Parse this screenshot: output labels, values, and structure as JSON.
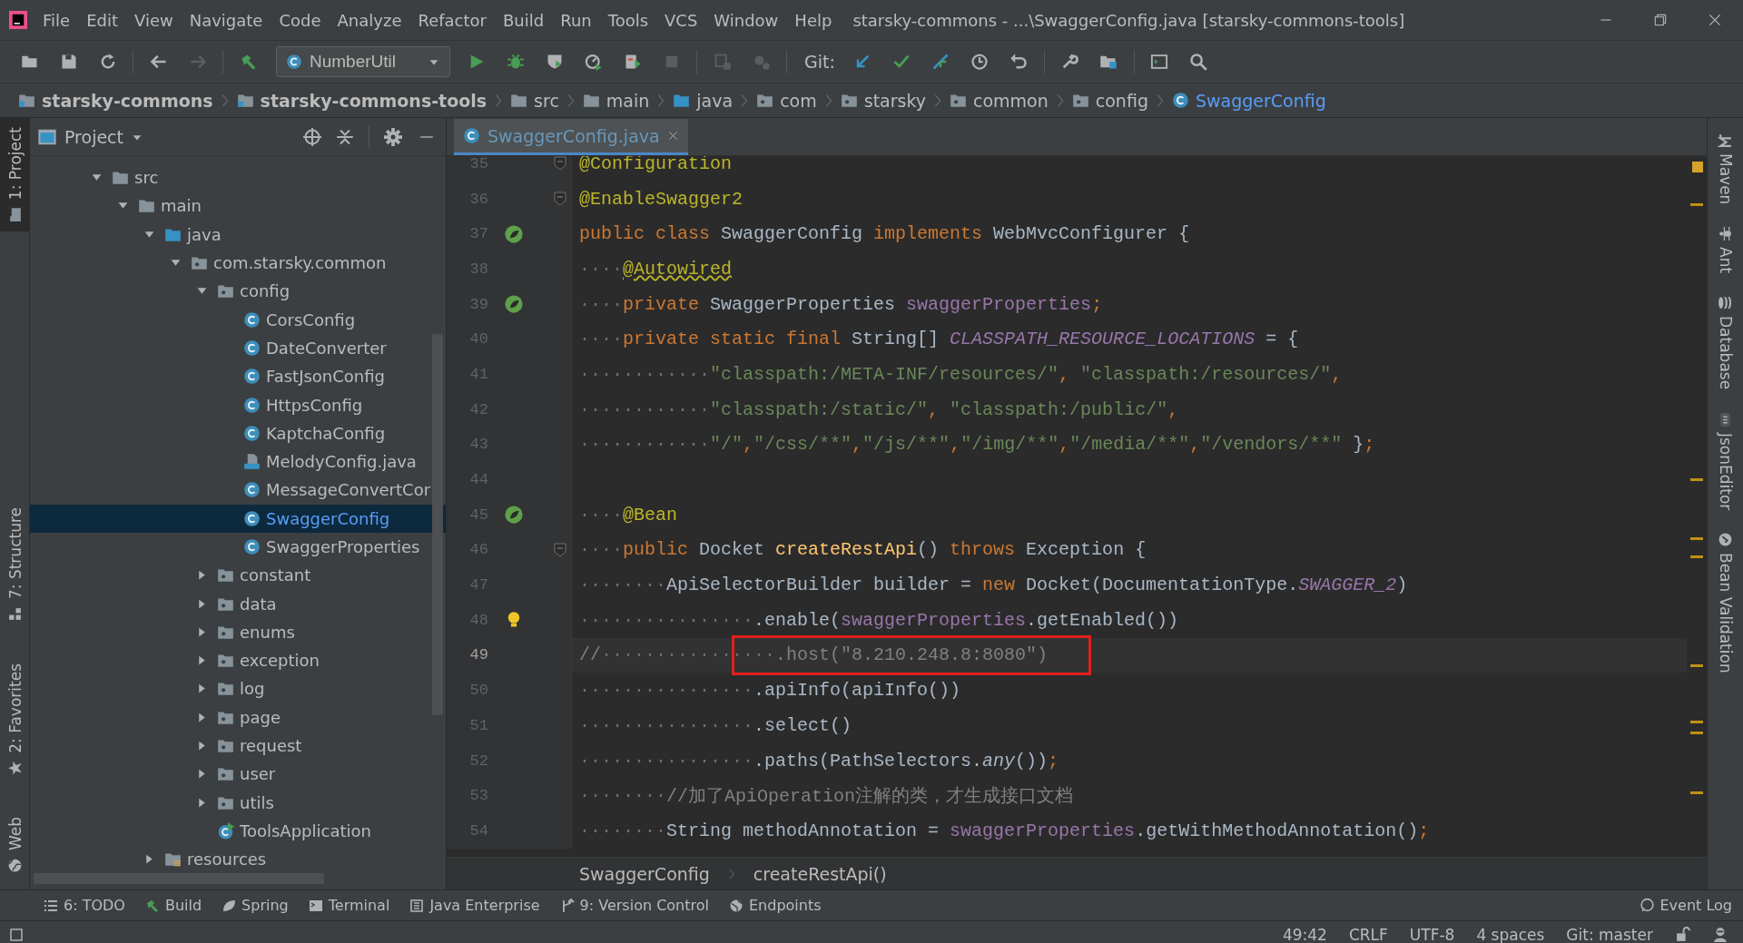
{
  "window": {
    "menu": [
      "File",
      "Edit",
      "View",
      "Navigate",
      "Code",
      "Analyze",
      "Refactor",
      "Build",
      "Run",
      "Tools",
      "VCS",
      "Window",
      "Help"
    ],
    "title": "starsky-commons - ...\\SwaggerConfig.java [starsky-commons-tools]"
  },
  "toolbar": {
    "run_config": "NumberUtil",
    "vcs_label": "Git:"
  },
  "breadcrumbs": [
    {
      "label": "starsky-commons",
      "kind": "module"
    },
    {
      "label": "starsky-commons-tools",
      "kind": "module"
    },
    {
      "label": "src",
      "kind": "folder"
    },
    {
      "label": "main",
      "kind": "folder"
    },
    {
      "label": "java",
      "kind": "source-folder"
    },
    {
      "label": "com",
      "kind": "package"
    },
    {
      "label": "starsky",
      "kind": "package"
    },
    {
      "label": "common",
      "kind": "package"
    },
    {
      "label": "config",
      "kind": "package"
    },
    {
      "label": "SwaggerConfig",
      "kind": "class"
    }
  ],
  "left_stripe": {
    "top": [
      {
        "label": "1: Project",
        "selected": true
      }
    ],
    "bottom": [
      {
        "label": "7: Structure",
        "selected": false
      },
      {
        "label": "2: Favorites",
        "selected": false
      },
      {
        "label": "Web",
        "selected": false
      }
    ]
  },
  "project": {
    "title": "Project",
    "tree": [
      {
        "label": "src",
        "kind": "folder",
        "expanded": true,
        "selected": false,
        "children": [
          {
            "label": "main",
            "kind": "folder",
            "expanded": true,
            "selected": false,
            "children": [
              {
                "label": "java",
                "kind": "source-folder",
                "expanded": true,
                "selected": false,
                "children": [
                  {
                    "label": "com.starsky.common",
                    "kind": "package",
                    "expanded": true,
                    "selected": false,
                    "children": [
                      {
                        "label": "config",
                        "kind": "package",
                        "expanded": true,
                        "selected": false,
                        "children": [
                          {
                            "label": "CorsConfig",
                            "kind": "class",
                            "selected": false
                          },
                          {
                            "label": "DateConverter",
                            "kind": "class",
                            "selected": false
                          },
                          {
                            "label": "FastJsonConfig",
                            "kind": "class",
                            "selected": false
                          },
                          {
                            "label": "HttpsConfig",
                            "kind": "class",
                            "selected": false
                          },
                          {
                            "label": "KaptchaConfig",
                            "kind": "class",
                            "selected": false
                          },
                          {
                            "label": "MelodyConfig.java",
                            "kind": "java-file",
                            "selected": false
                          },
                          {
                            "label": "MessageConvertCor",
                            "kind": "class",
                            "selected": false
                          },
                          {
                            "label": "SwaggerConfig",
                            "kind": "class",
                            "selected": true
                          },
                          {
                            "label": "SwaggerProperties",
                            "kind": "class",
                            "selected": false
                          }
                        ]
                      },
                      {
                        "label": "constant",
                        "kind": "package",
                        "expanded": false,
                        "selected": false
                      },
                      {
                        "label": "data",
                        "kind": "package",
                        "expanded": false,
                        "selected": false
                      },
                      {
                        "label": "enums",
                        "kind": "package",
                        "expanded": false,
                        "selected": false
                      },
                      {
                        "label": "exception",
                        "kind": "package",
                        "expanded": false,
                        "selected": false
                      },
                      {
                        "label": "log",
                        "kind": "package",
                        "expanded": false,
                        "selected": false
                      },
                      {
                        "label": "page",
                        "kind": "package",
                        "expanded": false,
                        "selected": false
                      },
                      {
                        "label": "request",
                        "kind": "package",
                        "expanded": false,
                        "selected": false
                      },
                      {
                        "label": "user",
                        "kind": "package",
                        "expanded": false,
                        "selected": false
                      },
                      {
                        "label": "utils",
                        "kind": "package",
                        "expanded": false,
                        "selected": false
                      },
                      {
                        "label": "ToolsApplication",
                        "kind": "app",
                        "selected": false
                      }
                    ]
                  }
                ]
              },
              {
                "label": "resources",
                "kind": "resources",
                "expanded": false,
                "selected": false
              }
            ]
          }
        ]
      }
    ]
  },
  "editor": {
    "tab": {
      "label": "SwaggerConfig.java",
      "selected": true
    },
    "lines": [
      {
        "number": "35",
        "current": false,
        "boxed": false,
        "gutter": {
          "kind": "fold"
        },
        "tokens": [
          {
            "kind": "ann",
            "t": "@Configuration"
          }
        ]
      },
      {
        "number": "36",
        "current": false,
        "boxed": false,
        "gutter": {
          "kind": "fold"
        },
        "tokens": [
          {
            "kind": "ann",
            "t": "@EnableSwagger2"
          }
        ]
      },
      {
        "number": "37",
        "current": false,
        "boxed": false,
        "gutter": {
          "kind": "bean"
        },
        "tokens": [
          {
            "kind": "kw",
            "t": "public class "
          },
          {
            "kind": "plain",
            "t": "SwaggerConfig "
          },
          {
            "kind": "kw",
            "t": "implements "
          },
          {
            "kind": "plain",
            "t": "WebMvcConfigurer {"
          }
        ]
      },
      {
        "number": "38",
        "current": false,
        "boxed": false,
        "tokens": [
          {
            "kind": "ws",
            "t": "····"
          },
          {
            "kind": "warn-ann",
            "t": "@Autowired"
          }
        ]
      },
      {
        "number": "39",
        "current": false,
        "boxed": false,
        "gutter": {
          "kind": "bean"
        },
        "tokens": [
          {
            "kind": "ws",
            "t": "····"
          },
          {
            "kind": "kw",
            "t": "private "
          },
          {
            "kind": "plain",
            "t": "SwaggerProperties "
          },
          {
            "kind": "field",
            "t": "swaggerProperties"
          },
          {
            "kind": "kw",
            "t": ";"
          }
        ]
      },
      {
        "number": "40",
        "current": false,
        "boxed": false,
        "tokens": [
          {
            "kind": "ws",
            "t": "····"
          },
          {
            "kind": "kw",
            "t": "private static final "
          },
          {
            "kind": "plain",
            "t": "String[] "
          },
          {
            "kind": "const",
            "t": "CLASSPATH_RESOURCE_LOCATIONS"
          },
          {
            "kind": "plain",
            "t": " = {"
          }
        ]
      },
      {
        "number": "41",
        "current": false,
        "boxed": false,
        "tokens": [
          {
            "kind": "ws",
            "t": "············"
          },
          {
            "kind": "str",
            "t": "\"classpath:/META-INF/resources/\""
          },
          {
            "kind": "kw",
            "t": ", "
          },
          {
            "kind": "str",
            "t": "\"classpath:/resources/\""
          },
          {
            "kind": "kw",
            "t": ","
          }
        ]
      },
      {
        "number": "42",
        "current": false,
        "boxed": false,
        "tokens": [
          {
            "kind": "ws",
            "t": "············"
          },
          {
            "kind": "str",
            "t": "\"classpath:/static/\""
          },
          {
            "kind": "kw",
            "t": ", "
          },
          {
            "kind": "str",
            "t": "\"classpath:/public/\""
          },
          {
            "kind": "kw",
            "t": ","
          }
        ]
      },
      {
        "number": "43",
        "current": false,
        "boxed": false,
        "tokens": [
          {
            "kind": "ws",
            "t": "············"
          },
          {
            "kind": "str",
            "t": "\"/\""
          },
          {
            "kind": "kw",
            "t": ","
          },
          {
            "kind": "str",
            "t": "\"/css/**\""
          },
          {
            "kind": "kw",
            "t": ","
          },
          {
            "kind": "str",
            "t": "\"/js/**\""
          },
          {
            "kind": "kw",
            "t": ","
          },
          {
            "kind": "str",
            "t": "\"/img/**\""
          },
          {
            "kind": "kw",
            "t": ","
          },
          {
            "kind": "str",
            "t": "\"/media/**\""
          },
          {
            "kind": "kw",
            "t": ","
          },
          {
            "kind": "str",
            "t": "\"/vendors/**\""
          },
          {
            "kind": "plain",
            "t": " }"
          },
          {
            "kind": "kw",
            "t": ";"
          }
        ]
      },
      {
        "number": "44",
        "current": false,
        "boxed": false
      },
      {
        "number": "45",
        "current": false,
        "boxed": false,
        "gutter": {
          "kind": "bean"
        },
        "tokens": [
          {
            "kind": "ws",
            "t": "····"
          },
          {
            "kind": "ann",
            "t": "@Bean"
          }
        ]
      },
      {
        "number": "46",
        "current": false,
        "boxed": false,
        "gutter": {
          "kind": "fold"
        },
        "tokens": [
          {
            "kind": "ws",
            "t": "····"
          },
          {
            "kind": "kw",
            "t": "public "
          },
          {
            "kind": "plain",
            "t": "Docket "
          },
          {
            "kind": "method",
            "t": "createRestApi"
          },
          {
            "kind": "plain",
            "t": "() "
          },
          {
            "kind": "kw",
            "t": "throws "
          },
          {
            "kind": "plain",
            "t": "Exception {"
          }
        ]
      },
      {
        "number": "47",
        "current": false,
        "boxed": false,
        "tokens": [
          {
            "kind": "ws",
            "t": "········"
          },
          {
            "kind": "plain",
            "t": "ApiSelectorBuilder builder = "
          },
          {
            "kind": "kw",
            "t": "new "
          },
          {
            "kind": "plain",
            "t": "Docket(DocumentationType."
          },
          {
            "kind": "const",
            "t": "SWAGGER_2"
          },
          {
            "kind": "plain",
            "t": ")"
          }
        ]
      },
      {
        "number": "48",
        "current": false,
        "boxed": false,
        "gutter": {
          "kind": "bulb"
        },
        "tokens": [
          {
            "kind": "ws",
            "t": "················"
          },
          {
            "kind": "plain",
            "t": ".enable("
          },
          {
            "kind": "field",
            "t": "swaggerProperties"
          },
          {
            "kind": "plain",
            "t": ".getEnabled())"
          }
        ]
      },
      {
        "number": "49",
        "current": true,
        "boxed": true,
        "tokens": [
          {
            "kind": "comment",
            "t": "//"
          },
          {
            "kind": "ws",
            "t": "················"
          },
          {
            "kind": "comment",
            "t": ".host(\"8.210.248.8:8080\")"
          }
        ]
      },
      {
        "number": "50",
        "current": false,
        "boxed": false,
        "tokens": [
          {
            "kind": "ws",
            "t": "················"
          },
          {
            "kind": "plain",
            "t": ".apiInfo(apiInfo())"
          }
        ]
      },
      {
        "number": "51",
        "current": false,
        "boxed": false,
        "tokens": [
          {
            "kind": "ws",
            "t": "················"
          },
          {
            "kind": "plain",
            "t": ".select()"
          }
        ]
      },
      {
        "number": "52",
        "current": false,
        "boxed": false,
        "tokens": [
          {
            "kind": "ws",
            "t": "················"
          },
          {
            "kind": "plain",
            "t": ".paths(PathSelectors."
          },
          {
            "kind": "static-call",
            "t": "any"
          },
          {
            "kind": "plain",
            "t": "())"
          },
          {
            "kind": "kw",
            "t": ";"
          }
        ]
      },
      {
        "number": "53",
        "current": false,
        "boxed": false,
        "tokens": [
          {
            "kind": "ws",
            "t": "········"
          },
          {
            "kind": "comment",
            "t": "//加了ApiOperation注解的类，才生成接口文档"
          }
        ]
      },
      {
        "number": "54",
        "current": false,
        "boxed": false,
        "tokens": [
          {
            "kind": "ws",
            "t": "········"
          },
          {
            "kind": "plain",
            "t": "String methodAnnotation = "
          },
          {
            "kind": "field",
            "t": "swaggerProperties"
          },
          {
            "kind": "plain",
            "t": ".getWithMethodAnnotation()"
          },
          {
            "kind": "kw",
            "t": ";"
          }
        ]
      }
    ],
    "breadcrumb": [
      "SwaggerConfig",
      "createRestApi()"
    ]
  },
  "right_stripe": [
    {
      "label": "Maven",
      "kind": "maven"
    },
    {
      "label": "Ant",
      "kind": "ant"
    },
    {
      "label": "Database",
      "kind": "database"
    },
    {
      "label": "JsonEditor",
      "kind": "json"
    },
    {
      "label": "Bean Validation",
      "kind": "bean"
    }
  ],
  "tool_windows": [
    {
      "label": "6: TODO",
      "kind": "todo"
    },
    {
      "label": "Build",
      "kind": "build"
    },
    {
      "label": "Spring",
      "kind": "spring"
    },
    {
      "label": "Terminal",
      "kind": "terminal"
    },
    {
      "label": "Java Enterprise",
      "kind": "enterprise"
    },
    {
      "label": "9: Version Control",
      "kind": "vcs"
    },
    {
      "label": "Endpoints",
      "kind": "endpoints"
    }
  ],
  "event_log": "Event Log",
  "status_bar": {
    "position": "49:42",
    "line_separator": "CRLF",
    "encoding": "UTF-8",
    "indent": "4 spaces",
    "branch": "Git: master"
  }
}
